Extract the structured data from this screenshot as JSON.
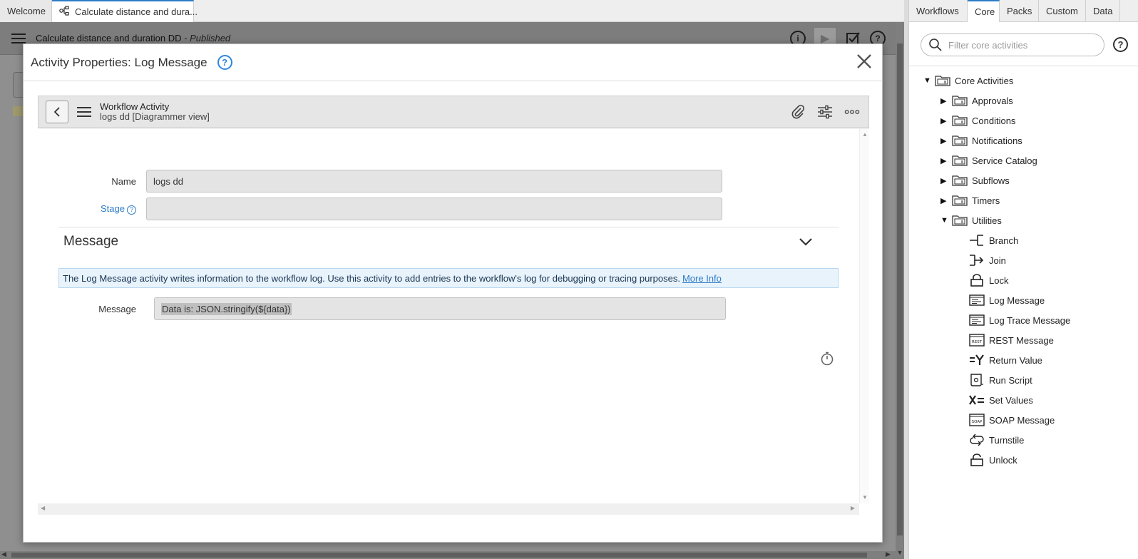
{
  "tabs": [
    {
      "label": "Welcome"
    },
    {
      "label": "Calculate distance and dura..."
    }
  ],
  "canvas": {
    "title": "Calculate distance and duration DD",
    "status": " - Published"
  },
  "modal": {
    "title": "Activity Properties: Log Message",
    "help": "?",
    "close": "✕",
    "form_header": {
      "title": "Workflow Activity",
      "subtitle": "logs dd [Diagrammer view]"
    },
    "fields": {
      "name_label": "Name",
      "name_value": "logs dd",
      "stage_label": "Stage",
      "stage_value": ""
    },
    "section": {
      "title": "Message",
      "info_text": "The Log Message activity writes information to the workflow log. Use this activity to add entries to the workflow's log for debugging or tracing purposes.",
      "info_link": "More Info",
      "message_label": "Message",
      "message_value": "Data is: JSON.stringify(${data})"
    }
  },
  "right_panel": {
    "tabs": [
      {
        "label": "Workflows"
      },
      {
        "label": "Core"
      },
      {
        "label": "Packs"
      },
      {
        "label": "Custom"
      },
      {
        "label": "Data"
      }
    ],
    "search_placeholder": "Filter core activities",
    "help": "?",
    "tree": {
      "root": "Core Activities",
      "folders": [
        {
          "label": "Approvals"
        },
        {
          "label": "Conditions"
        },
        {
          "label": "Notifications"
        },
        {
          "label": "Service Catalog"
        },
        {
          "label": "Subflows"
        },
        {
          "label": "Timers"
        },
        {
          "label": "Utilities"
        }
      ],
      "utilities": [
        {
          "label": "Branch",
          "icon": "branch-icon"
        },
        {
          "label": "Join",
          "icon": "join-icon"
        },
        {
          "label": "Lock",
          "icon": "lock-icon"
        },
        {
          "label": "Log Message",
          "icon": "log-message-icon"
        },
        {
          "label": "Log Trace Message",
          "icon": "log-trace-icon"
        },
        {
          "label": "REST Message",
          "icon": "rest-icon"
        },
        {
          "label": "Return Value",
          "icon": "return-value-icon"
        },
        {
          "label": "Run Script",
          "icon": "script-icon"
        },
        {
          "label": "Set Values",
          "icon": "set-values-icon"
        },
        {
          "label": "SOAP Message",
          "icon": "soap-icon"
        },
        {
          "label": "Turnstile",
          "icon": "turnstile-icon"
        },
        {
          "label": "Unlock",
          "icon": "unlock-icon"
        }
      ]
    }
  }
}
